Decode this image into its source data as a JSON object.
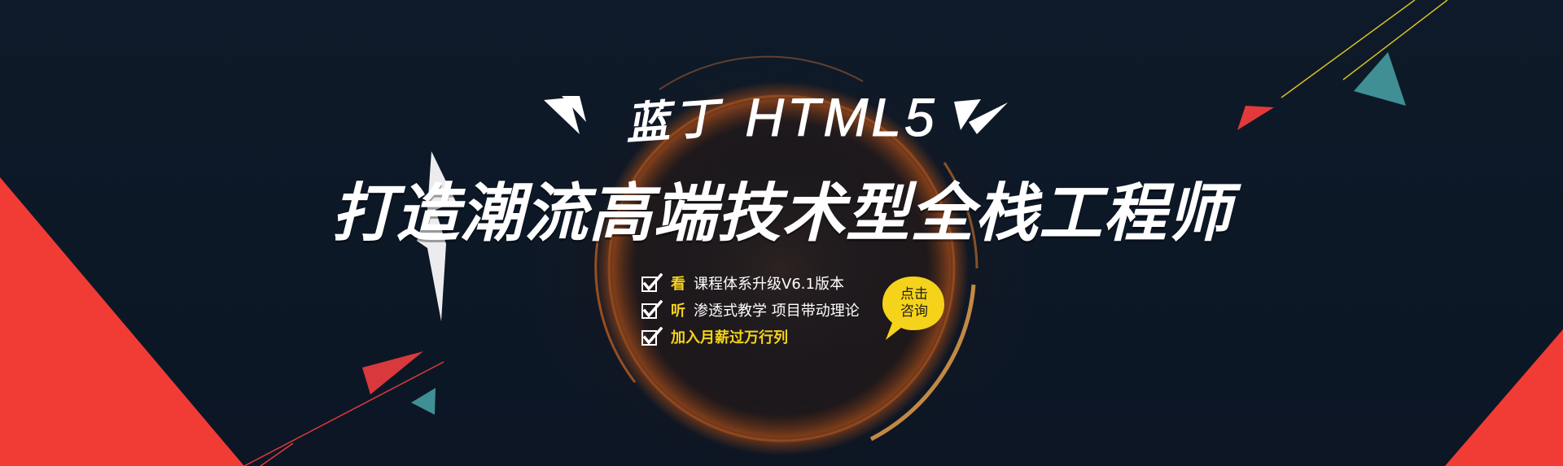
{
  "banner": {
    "brand": {
      "name": "蓝丁",
      "product": "HTML5"
    },
    "title": "打造潮流高端技术型全栈工程师",
    "features": [
      {
        "key": "看",
        "text": "课程体系升级V6.1版本",
        "highlight": false
      },
      {
        "key": "听",
        "text": "渗透式教学 项目带动理论",
        "highlight": false
      },
      {
        "key": "",
        "text": "加入月薪过万行列",
        "highlight": true
      }
    ],
    "cta": {
      "line1": "点击",
      "line2": "咨询"
    }
  },
  "colors": {
    "background": "#0d1826",
    "accent_red": "#f03c35",
    "accent_teal": "#3f8f94",
    "accent_yellow": "#f5d31a",
    "ring_orange": "#ff7a1e",
    "text_white": "#ffffff"
  },
  "icons": {
    "check": "checkbox-checked-icon",
    "speech": "speech-bubble-icon"
  }
}
